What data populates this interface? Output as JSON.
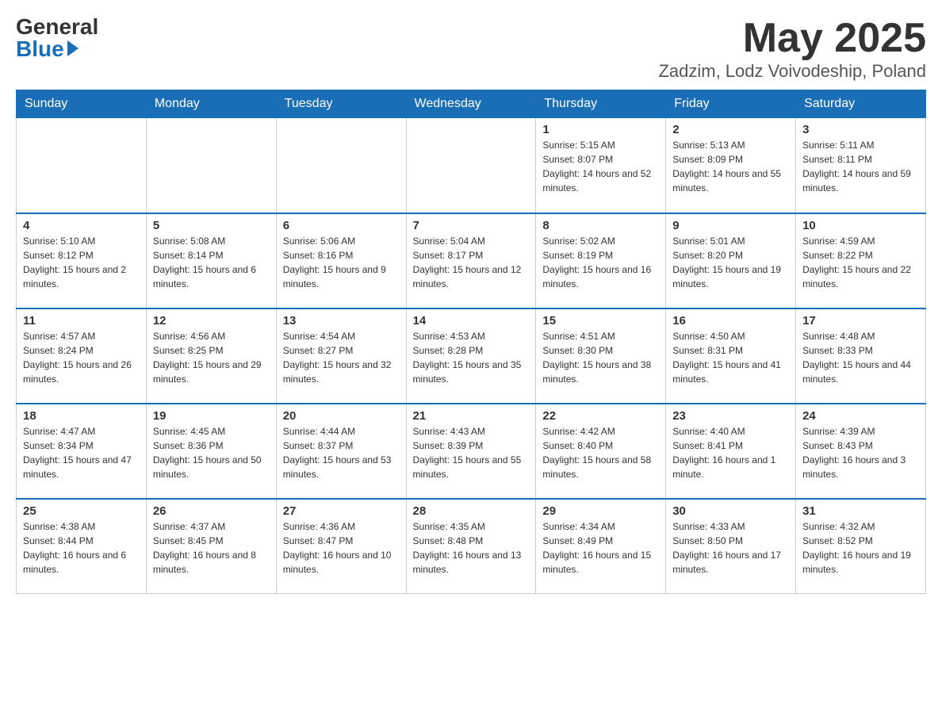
{
  "header": {
    "logo_general": "General",
    "logo_blue": "Blue",
    "month_title": "May 2025",
    "location": "Zadzim, Lodz Voivodeship, Poland"
  },
  "days_of_week": [
    "Sunday",
    "Monday",
    "Tuesday",
    "Wednesday",
    "Thursday",
    "Friday",
    "Saturday"
  ],
  "weeks": [
    [
      {
        "day": "",
        "info": ""
      },
      {
        "day": "",
        "info": ""
      },
      {
        "day": "",
        "info": ""
      },
      {
        "day": "",
        "info": ""
      },
      {
        "day": "1",
        "info": "Sunrise: 5:15 AM\nSunset: 8:07 PM\nDaylight: 14 hours and 52 minutes."
      },
      {
        "day": "2",
        "info": "Sunrise: 5:13 AM\nSunset: 8:09 PM\nDaylight: 14 hours and 55 minutes."
      },
      {
        "day": "3",
        "info": "Sunrise: 5:11 AM\nSunset: 8:11 PM\nDaylight: 14 hours and 59 minutes."
      }
    ],
    [
      {
        "day": "4",
        "info": "Sunrise: 5:10 AM\nSunset: 8:12 PM\nDaylight: 15 hours and 2 minutes."
      },
      {
        "day": "5",
        "info": "Sunrise: 5:08 AM\nSunset: 8:14 PM\nDaylight: 15 hours and 6 minutes."
      },
      {
        "day": "6",
        "info": "Sunrise: 5:06 AM\nSunset: 8:16 PM\nDaylight: 15 hours and 9 minutes."
      },
      {
        "day": "7",
        "info": "Sunrise: 5:04 AM\nSunset: 8:17 PM\nDaylight: 15 hours and 12 minutes."
      },
      {
        "day": "8",
        "info": "Sunrise: 5:02 AM\nSunset: 8:19 PM\nDaylight: 15 hours and 16 minutes."
      },
      {
        "day": "9",
        "info": "Sunrise: 5:01 AM\nSunset: 8:20 PM\nDaylight: 15 hours and 19 minutes."
      },
      {
        "day": "10",
        "info": "Sunrise: 4:59 AM\nSunset: 8:22 PM\nDaylight: 15 hours and 22 minutes."
      }
    ],
    [
      {
        "day": "11",
        "info": "Sunrise: 4:57 AM\nSunset: 8:24 PM\nDaylight: 15 hours and 26 minutes."
      },
      {
        "day": "12",
        "info": "Sunrise: 4:56 AM\nSunset: 8:25 PM\nDaylight: 15 hours and 29 minutes."
      },
      {
        "day": "13",
        "info": "Sunrise: 4:54 AM\nSunset: 8:27 PM\nDaylight: 15 hours and 32 minutes."
      },
      {
        "day": "14",
        "info": "Sunrise: 4:53 AM\nSunset: 8:28 PM\nDaylight: 15 hours and 35 minutes."
      },
      {
        "day": "15",
        "info": "Sunrise: 4:51 AM\nSunset: 8:30 PM\nDaylight: 15 hours and 38 minutes."
      },
      {
        "day": "16",
        "info": "Sunrise: 4:50 AM\nSunset: 8:31 PM\nDaylight: 15 hours and 41 minutes."
      },
      {
        "day": "17",
        "info": "Sunrise: 4:48 AM\nSunset: 8:33 PM\nDaylight: 15 hours and 44 minutes."
      }
    ],
    [
      {
        "day": "18",
        "info": "Sunrise: 4:47 AM\nSunset: 8:34 PM\nDaylight: 15 hours and 47 minutes."
      },
      {
        "day": "19",
        "info": "Sunrise: 4:45 AM\nSunset: 8:36 PM\nDaylight: 15 hours and 50 minutes."
      },
      {
        "day": "20",
        "info": "Sunrise: 4:44 AM\nSunset: 8:37 PM\nDaylight: 15 hours and 53 minutes."
      },
      {
        "day": "21",
        "info": "Sunrise: 4:43 AM\nSunset: 8:39 PM\nDaylight: 15 hours and 55 minutes."
      },
      {
        "day": "22",
        "info": "Sunrise: 4:42 AM\nSunset: 8:40 PM\nDaylight: 15 hours and 58 minutes."
      },
      {
        "day": "23",
        "info": "Sunrise: 4:40 AM\nSunset: 8:41 PM\nDaylight: 16 hours and 1 minute."
      },
      {
        "day": "24",
        "info": "Sunrise: 4:39 AM\nSunset: 8:43 PM\nDaylight: 16 hours and 3 minutes."
      }
    ],
    [
      {
        "day": "25",
        "info": "Sunrise: 4:38 AM\nSunset: 8:44 PM\nDaylight: 16 hours and 6 minutes."
      },
      {
        "day": "26",
        "info": "Sunrise: 4:37 AM\nSunset: 8:45 PM\nDaylight: 16 hours and 8 minutes."
      },
      {
        "day": "27",
        "info": "Sunrise: 4:36 AM\nSunset: 8:47 PM\nDaylight: 16 hours and 10 minutes."
      },
      {
        "day": "28",
        "info": "Sunrise: 4:35 AM\nSunset: 8:48 PM\nDaylight: 16 hours and 13 minutes."
      },
      {
        "day": "29",
        "info": "Sunrise: 4:34 AM\nSunset: 8:49 PM\nDaylight: 16 hours and 15 minutes."
      },
      {
        "day": "30",
        "info": "Sunrise: 4:33 AM\nSunset: 8:50 PM\nDaylight: 16 hours and 17 minutes."
      },
      {
        "day": "31",
        "info": "Sunrise: 4:32 AM\nSunset: 8:52 PM\nDaylight: 16 hours and 19 minutes."
      }
    ]
  ]
}
